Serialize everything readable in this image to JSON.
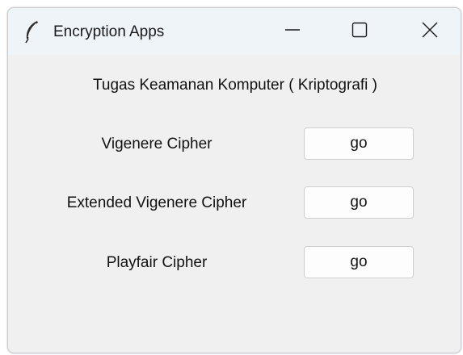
{
  "window": {
    "title": "Encryption Apps",
    "icon": "feather-icon",
    "controls": [
      "minimize-icon",
      "maximize-icon",
      "close-icon"
    ]
  },
  "main": {
    "heading": "Tugas Keamanan Komputer ( Kriptografi )",
    "rows": [
      {
        "label": "Vigenere Cipher",
        "button_label": "go"
      },
      {
        "label": "Extended Vigenere Cipher",
        "button_label": "go"
      },
      {
        "label": "Playfair Cipher",
        "button_label": "go"
      }
    ]
  },
  "colors": {
    "window_background": "#f0f0f0",
    "titlebar_background": "#eff4f9",
    "button_background": "#fdfdfd",
    "button_border": "#cfcfcf"
  }
}
